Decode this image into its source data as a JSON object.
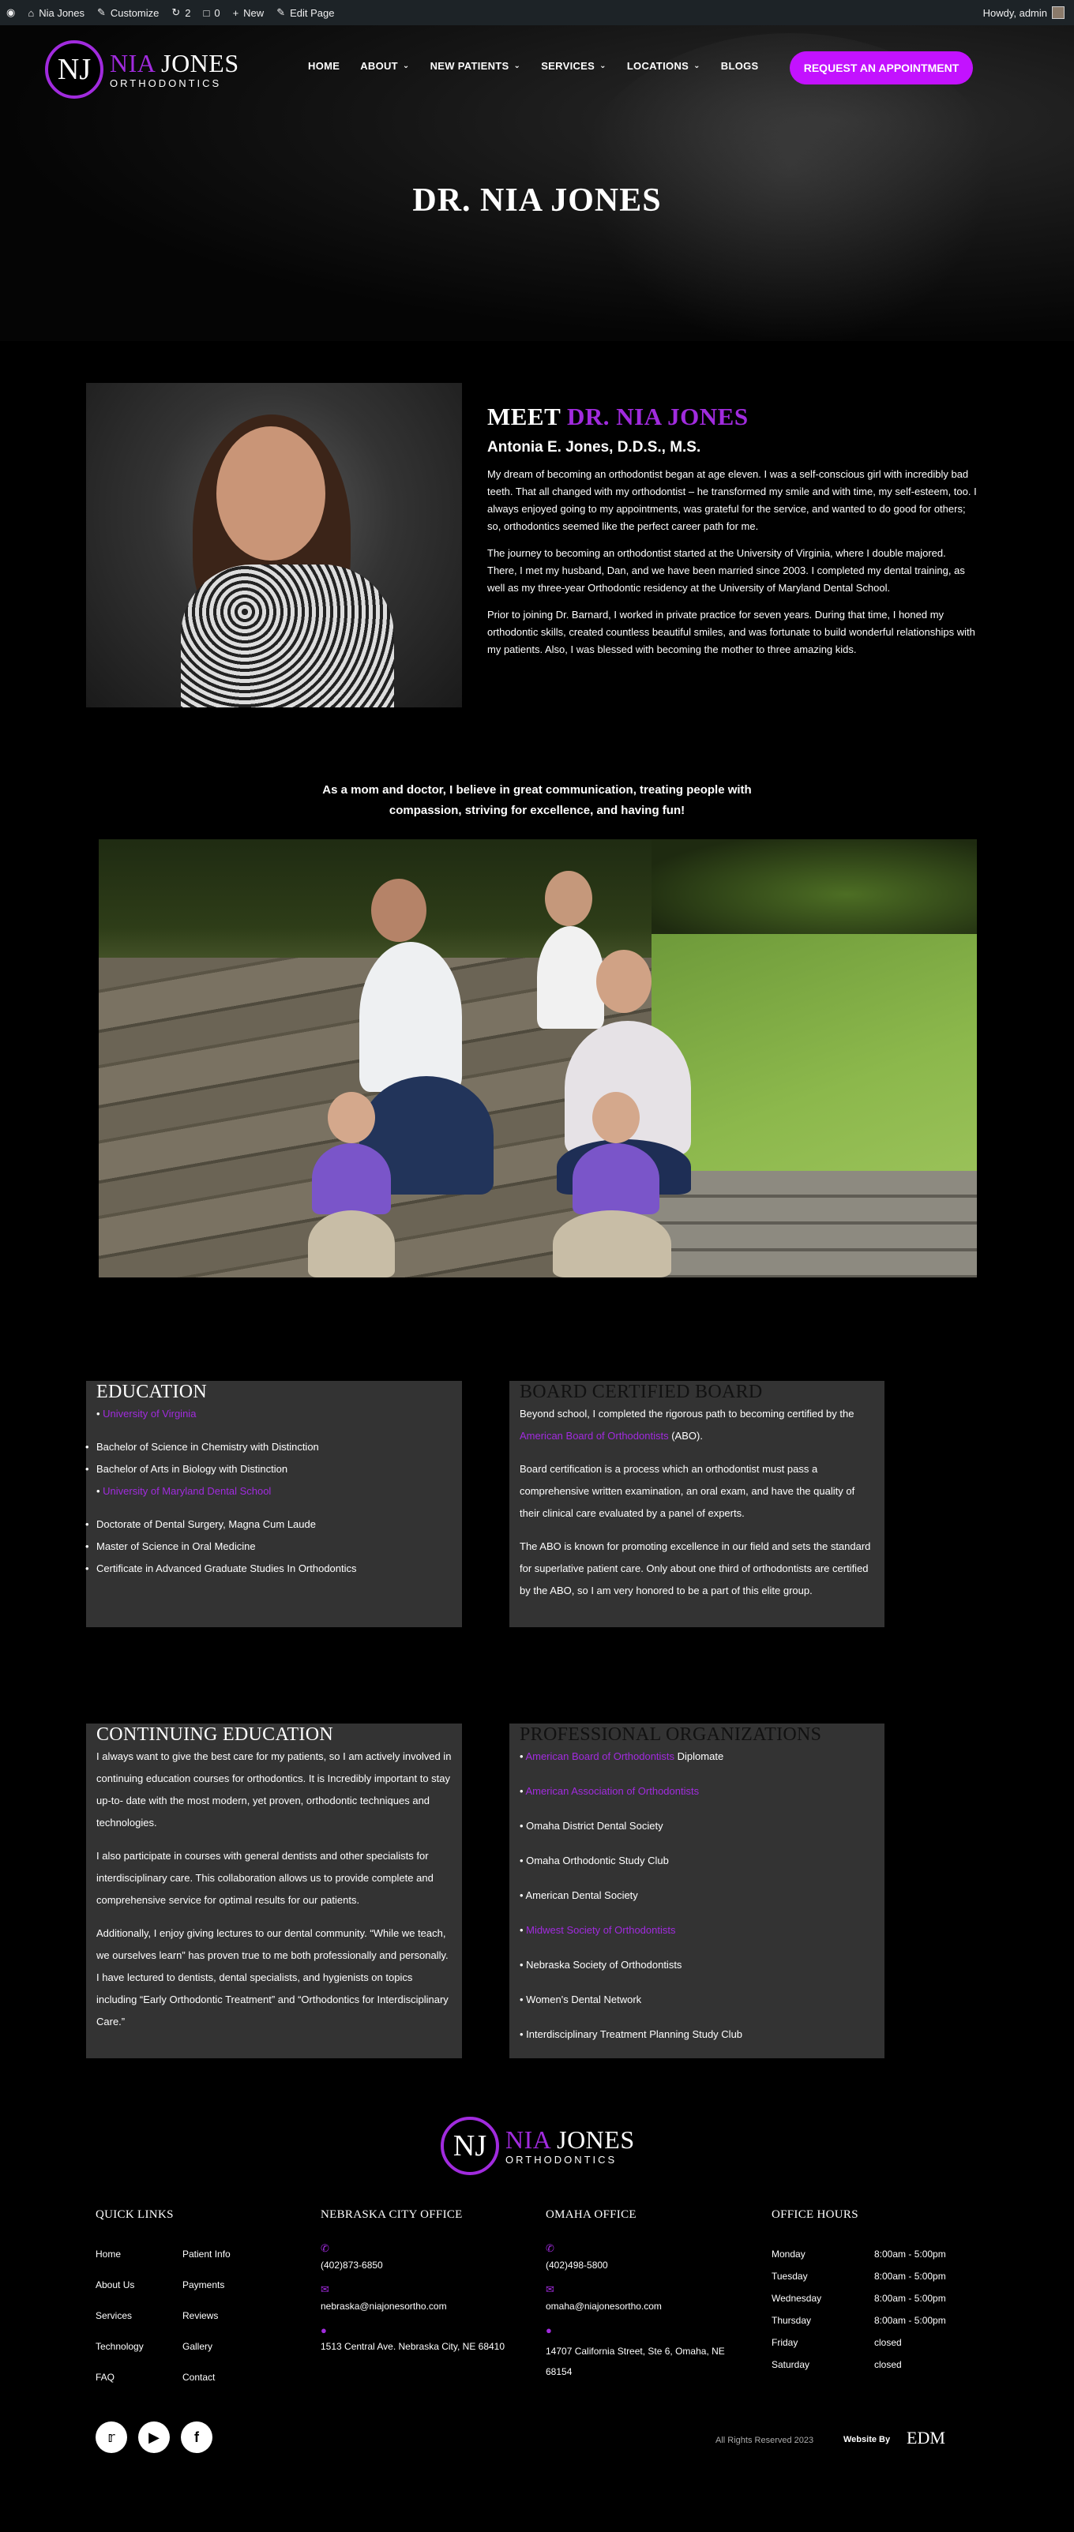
{
  "adminbar": {
    "site": "Nia Jones",
    "customize": "Customize",
    "updates": "2",
    "comments": "0",
    "new": "New",
    "edit": "Edit Page",
    "howdy": "Howdy, admin"
  },
  "logo": {
    "mark": "NJ",
    "name_first": "NIA",
    "name_last": "JONES",
    "tagline": "ORTHODONTICS"
  },
  "nav": {
    "items": [
      "HOME",
      "ABOUT",
      "NEW PATIENTS",
      "SERVICES",
      "LOCATIONS",
      "BLOGS"
    ],
    "cta": "REQUEST AN APPOINTMENT"
  },
  "hero": {
    "title": "DR. NIA JONES"
  },
  "meet": {
    "heading_a": "MEET ",
    "heading_b": "DR. NIA JONES",
    "subheading": "Antonia E. Jones, D.D.S., M.S.",
    "p1": "My dream of becoming an orthodontist began at age eleven. I was a self-conscious girl with incredibly bad teeth. That all changed with my orthodontist – he transformed my smile and with time, my self-esteem, too. I always enjoyed going to my appointments, was grateful for the service, and wanted to do good for others; so, orthodontics seemed like the perfect career path for me.",
    "p2": "The journey to becoming an orthodontist started at the University of Virginia, where I double majored. There, I met my husband, Dan, and we have been married since 2003. I completed my dental training, as well as my three-year Orthodontic residency at the University of Maryland Dental School.",
    "p3": "Prior to joining Dr. Barnard, I worked in private practice for seven years. During that time, I honed my orthodontic skills, created countless beautiful smiles, and was fortunate to build wonderful relationships with my patients. Also, I was blessed with becoming the mother to three amazing kids."
  },
  "quote": "As a mom and doctor, I believe in great communication, treating people with compassion, striving for excellence, and having fun!",
  "education": {
    "title": "EDUCATION",
    "uva": "University of Virginia",
    "uva_items": [
      "Bachelor of Science in Chemistry with Distinction",
      "Bachelor of Arts in Biology with Distinction"
    ],
    "umd": "University of Maryland Dental School",
    "umd_items": [
      "Doctorate of Dental Surgery, Magna Cum Laude",
      "Master of Science in Oral Medicine",
      "Certificate in Advanced Graduate Studies In Orthodontics"
    ]
  },
  "board": {
    "title": "BOARD CERTIFIED BOARD",
    "p1_a": "Beyond school, I completed the rigorous path to becoming certified by the ",
    "p1_link": "American Board of Orthodontists",
    "p1_b": " (ABO).",
    "p2": "Board certification is a process which an orthodontist must pass a comprehensive written examination, an oral exam, and have the quality of their clinical care evaluated by a panel of experts.",
    "p3": "The ABO is known for promoting excellence in our field and sets the standard for superlative patient care. Only about one third of orthodontists are certified by the ABO, so I am very honored to be a part of this elite group."
  },
  "continuing": {
    "title": "CONTINUING EDUCATION",
    "p1": "I always want to give the best care for my patients, so I am actively involved in continuing education courses for orthodontics. It is Incredibly important to stay up-to- date with the most modern, yet proven, orthodontic techniques and technologies.",
    "p2": "I also participate in courses with general dentists and other specialists for interdisciplinary care. This collaboration allows us to provide complete and comprehensive service for optimal results for our patients.",
    "p3": "Additionally, I enjoy giving lectures to our dental community. “While we teach, we ourselves learn” has proven true to me both professionally and personally. I have lectured to dentists, dental specialists, and hygienists on topics including “Early Orthodontic Treatment” and “Orthodontics for Interdisciplinary Care.”"
  },
  "organizations": {
    "title": "PROFESSIONAL ORGANIZATIONS",
    "abo": "American Board of Orthodontists",
    "abo_suffix": " Diplomate",
    "aao": "American Association of Orthodontists",
    "items_a": [
      "Omaha District Dental Society",
      "Omaha Orthodontic Study Club",
      "American Dental Society"
    ],
    "msoo": "Midwest Society of Orthodontists",
    "items_b": [
      "Nebraska Society of Orthodontists",
      "Women's Dental Network",
      "Interdisciplinary Treatment Planning Study Club"
    ]
  },
  "footer": {
    "quick_links_title": "QUICK LINKS",
    "quick_links": [
      "Home",
      "Patient Info",
      "About Us",
      "Payments",
      "Services",
      "Reviews",
      "Technology",
      "Gallery",
      "FAQ",
      "Contact"
    ],
    "nc_title": "NEBRASKA CITY OFFICE",
    "nc_phone": "(402)873-6850",
    "nc_email": "nebraska@niajonesortho.com",
    "nc_address": "1513 Central Ave. Nebraska City, NE 68410",
    "om_title": "OMAHA OFFICE",
    "om_phone": "(402)498-5800",
    "om_email": "omaha@niajonesortho.com",
    "om_address": "14707 California Street, Ste 6, Omaha, NE 68154",
    "hours_title": "OFFICE HOURS",
    "hours": [
      [
        "Monday",
        "8:00am - 5:00pm"
      ],
      [
        "Tuesday",
        "8:00am - 5:00pm"
      ],
      [
        "Wednesday",
        "8:00am - 5:00pm"
      ],
      [
        "Thursday",
        "8:00am - 5:00pm"
      ],
      [
        "Friday",
        "closed"
      ],
      [
        "Saturday",
        "closed"
      ]
    ],
    "copyright": "All Rights Reserved 2023",
    "website_by": "Website By",
    "edm": "EDM"
  },
  "colors": {
    "accent": "#a12bde",
    "cta": "#c312ff",
    "panel": "#333333"
  }
}
